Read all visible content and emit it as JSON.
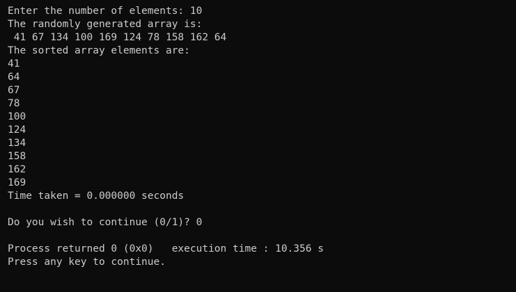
{
  "console": {
    "lines": [
      "Enter the number of elements: 10",
      "The randomly generated array is:",
      " 41 67 134 100 169 124 78 158 162 64",
      "The sorted array elements are:",
      "41",
      "64",
      "67",
      "78",
      "100",
      "124",
      "134",
      "158",
      "162",
      "169",
      "Time taken = 0.000000 seconds",
      "",
      "Do you wish to continue (0/1)? 0",
      "",
      "Process returned 0 (0x0)   execution time : 10.356 s",
      "Press any key to continue."
    ]
  },
  "colors": {
    "background": "#0c0c0c",
    "text": "#cccccc"
  }
}
